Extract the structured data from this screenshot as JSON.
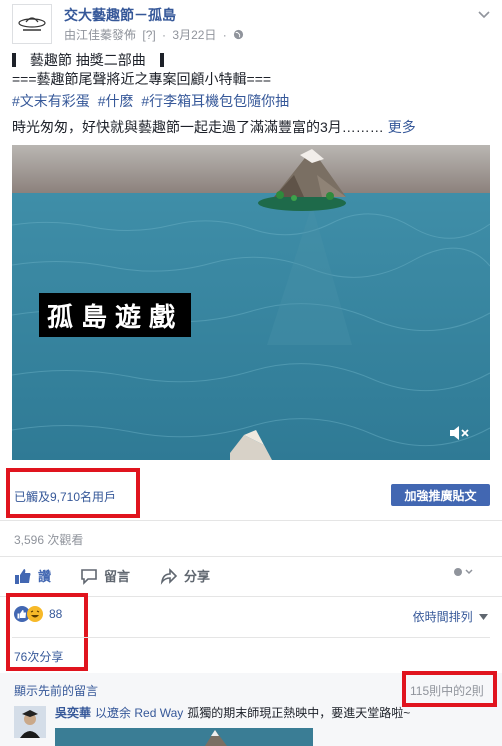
{
  "header": {
    "page_name": "交大藝趣節－孤島",
    "posted_by": "由江佳蓁發佈",
    "badge": "[?]",
    "date": "3月22日",
    "privacy_icon": "globe-icon",
    "menu_icon": "chevron-down-icon"
  },
  "post": {
    "title": "藝趣節 抽獎二部曲",
    "subtitle": "===藝趣節尾聲將近之專案回顧小特輯===",
    "hashtags": [
      "#文末有彩蛋",
      "#什麽",
      "#行李箱耳機包包隨你抽"
    ],
    "body": "時光匆匆，好快就與藝趣節一起走過了滿滿豐富的3月………",
    "more": "更多"
  },
  "video": {
    "overlay_title": "孤島遊戲",
    "mute_icon": "mute-icon"
  },
  "stats": {
    "reach": "已觸及9,710名用戶",
    "boost": "加強推廣貼文",
    "views": "3,596 次觀看"
  },
  "actions": {
    "like": "讚",
    "comment": "留言",
    "share": "分享"
  },
  "reactions": {
    "count": "88",
    "shares": "76次分享",
    "sort": "依時間排列"
  },
  "comments": {
    "prev": "顯示先前的留言",
    "count": "115則中的2則",
    "commenter": "吳奕華",
    "as_label": "以遼余 Red Way",
    "text": "孤獨的期末師現正熱映中，要進天堂路啦~"
  },
  "colors": {
    "link": "#365899",
    "highlight": "#e0141e",
    "boost": "#4267b2",
    "sea": "#3a8aa5"
  }
}
